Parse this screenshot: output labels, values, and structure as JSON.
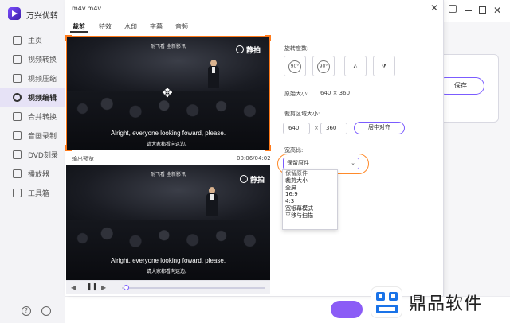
{
  "app": {
    "title": "万兴优转"
  },
  "sidebar": {
    "items": [
      {
        "label": "主页"
      },
      {
        "label": "视频转换"
      },
      {
        "label": "视频压缩"
      },
      {
        "label": "视频编辑"
      },
      {
        "label": "合并转换"
      },
      {
        "label": "音画录制"
      },
      {
        "label": "DVD刻录"
      },
      {
        "label": "播放器"
      },
      {
        "label": "工具箱"
      }
    ],
    "active_index": 3,
    "help_glyph": "?"
  },
  "background": {
    "save_label": "保存"
  },
  "dialog": {
    "title": "m4v.m4v",
    "tabs": [
      {
        "label": "裁剪"
      },
      {
        "label": "特效"
      },
      {
        "label": "水印"
      },
      {
        "label": "字幕"
      },
      {
        "label": "音频"
      }
    ],
    "active_tab": "裁剪",
    "video": {
      "top_caption": "耐飞看 全新影讯",
      "logo_text": "静拍",
      "subtitle_en": "Alright, everyone looking foward, please.",
      "subtitle_cn": "请大家都看向这边。"
    },
    "preview_label": "输出预览",
    "time": "00:06/04:02",
    "player": {
      "progress": 0.02
    },
    "rotation": {
      "label": "旋转度数:",
      "buttons": [
        {
          "text": "90°"
        },
        {
          "text": "90°"
        }
      ]
    },
    "original_size": {
      "label": "原始大小:",
      "value": "640 × 360"
    },
    "crop_area": {
      "label": "裁剪区域大小:",
      "width": "640",
      "times": "×",
      "height": "360",
      "center_button": "居中对齐"
    },
    "aspect_ratio": {
      "label": "宽高比:",
      "selected": "保留原件",
      "options": [
        "保留原件",
        "裁剪大小",
        "全屏",
        "16:9",
        "4:3",
        "宽银幕模式",
        "平移与扫描"
      ]
    }
  },
  "watermark_brand": {
    "text": "鼎品软件"
  },
  "colors": {
    "accent": "#7b5cff",
    "crop": "#ff7a1a",
    "active_nav": "#e6e2f6"
  }
}
